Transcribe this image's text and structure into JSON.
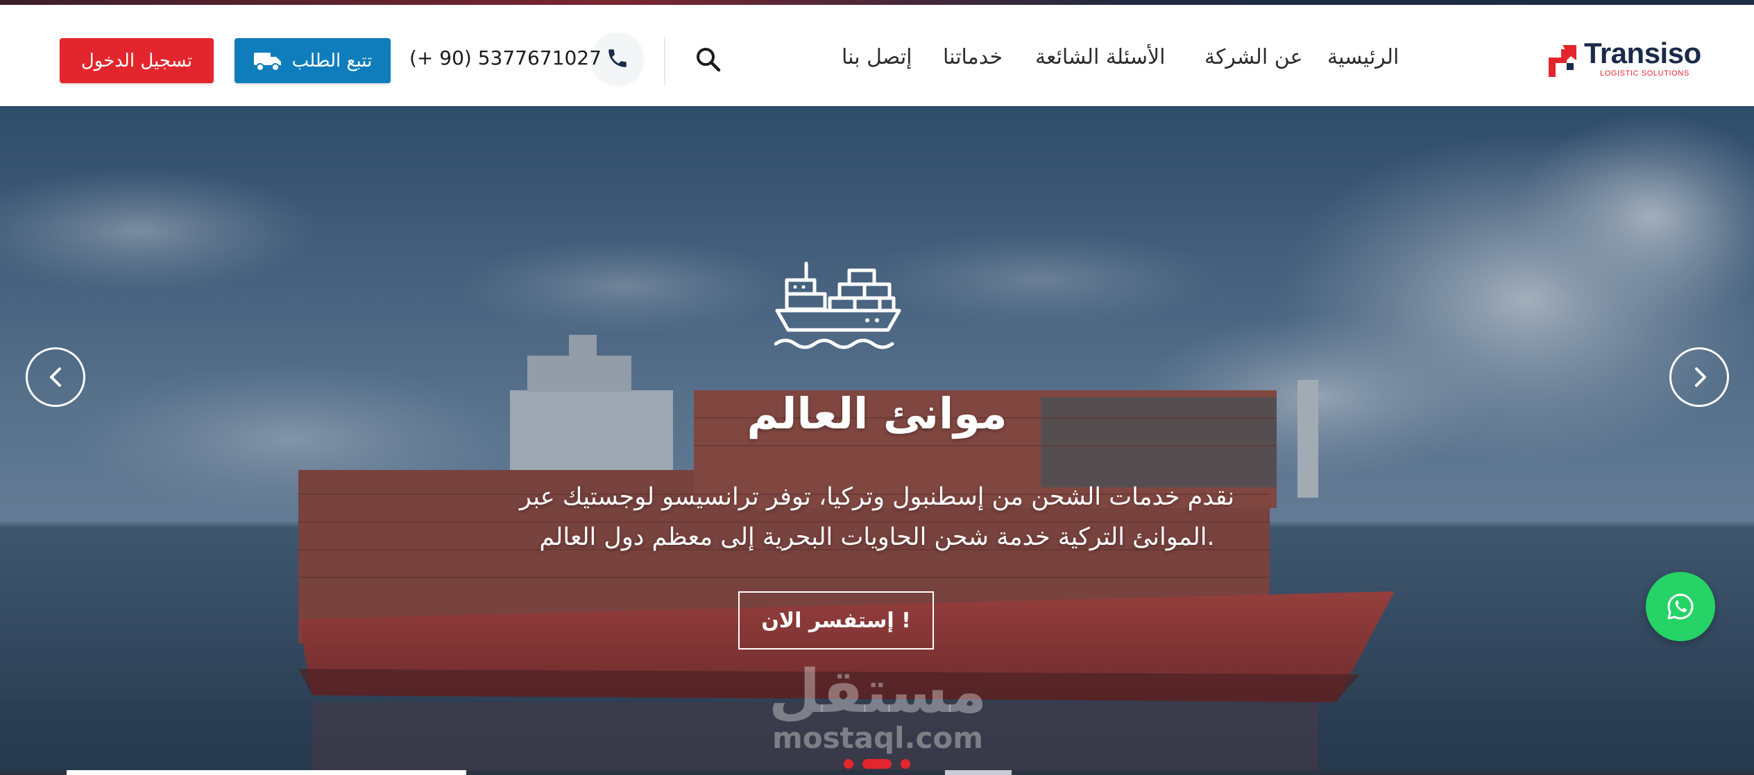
{
  "brand": {
    "name": "Transiso",
    "tagline": "LOGISTIC SOLUTIONS",
    "logo_icon": "transiso-logo-mark"
  },
  "nav": {
    "items": [
      {
        "label": "الرئيسية"
      },
      {
        "label": "عن الشركة"
      },
      {
        "label": "الأسئلة الشائعة"
      },
      {
        "label": "خدماتنا"
      },
      {
        "label": "إتصل بنا"
      }
    ]
  },
  "header": {
    "search_icon": "search-icon",
    "phone_icon": "phone-icon",
    "phone_number": "(+ 90) 5377671027",
    "track_button": "تتبع الطلب",
    "track_icon": "truck-icon",
    "login_button": "تسجيل الدخول"
  },
  "hero": {
    "icon": "cargo-ship-icon",
    "title": "موانئ العالم",
    "description_line1": "نقدم خدمات الشحن من إسطنبول وتركيا، توفر ترانسيسو لوجستيك عبر",
    "description_line2": "الموانئ التركية خدمة شحن الحاويات البحرية إلى معظم دول العالم.",
    "cta_button": "إستفسر الان !",
    "prev_icon": "chevron-left-icon",
    "next_icon": "chevron-right-icon",
    "slides_count": 3,
    "active_slide": 2
  },
  "watermark": {
    "arabic": "مستقل",
    "latin": "mostaql.com"
  },
  "whatsapp": {
    "icon": "whatsapp-icon"
  },
  "colors": {
    "brand_red": "#e3262d",
    "brand_blue": "#0f7dbb",
    "navy": "#1a2a4a",
    "whatsapp_green": "#25d366"
  }
}
